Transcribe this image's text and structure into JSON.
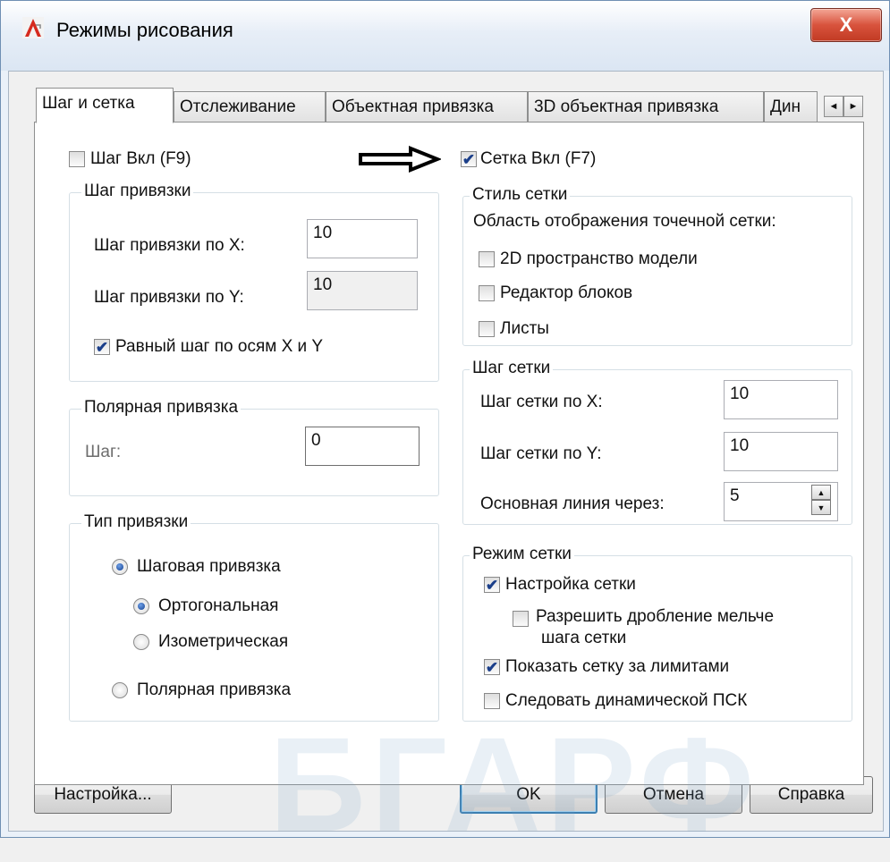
{
  "window": {
    "title": "Режимы рисования",
    "close_glyph": "X"
  },
  "tabs": [
    "Шаг и сетка",
    "Отслеживание",
    "Объектная привязка",
    "3D объектная привязка",
    "Дин"
  ],
  "tab_scroll": {
    "left": "◄",
    "right": "►"
  },
  "snap_on": {
    "label": "Шаг Вкл (F9)",
    "checked": false
  },
  "grid_on": {
    "label": "Сетка Вкл (F7)",
    "checked": true
  },
  "snap_spacing": {
    "title": "Шаг привязки",
    "x_label": "Шаг привязки по X:",
    "x_value": "10",
    "y_label": "Шаг привязки по Y:",
    "y_value": "10",
    "equal_label": "Равный шаг по осям X и Y",
    "equal_checked": true
  },
  "polar_spacing": {
    "title": "Полярная привязка",
    "label": "Шаг:",
    "value": "0"
  },
  "snap_type": {
    "title": "Тип привязки",
    "grid_snap": "Шаговая привязка",
    "rectangular": "Ортогональная",
    "isometric": "Изометрическая",
    "polar": "Полярная привязка"
  },
  "grid_style": {
    "title": "Стиль сетки",
    "subtitle": "Область отображения точечной сетки:",
    "model_space": "2D пространство модели",
    "block_editor": "Редактор блоков",
    "sheets": "Листы"
  },
  "grid_spacing": {
    "title": "Шаг сетки",
    "x_label": "Шаг сетки по X:",
    "x_value": "10",
    "y_label": "Шаг сетки по Y:",
    "y_value": "10",
    "major_label": "Основная линия через:",
    "major_value": "5"
  },
  "grid_behavior": {
    "title": "Режим сетки",
    "adaptive": "Настройка сетки",
    "subdivision_line1": "Разрешить дробление мельче",
    "subdivision_line2": "шага сетки",
    "beyond_limits": "Показать сетку за лимитами",
    "follow_ucs": "Следовать динамической ПСК"
  },
  "buttons": {
    "options": "Настройка...",
    "ok": "OK",
    "cancel": "Отмена",
    "help": "Справка"
  },
  "watermark": "БГАРФ"
}
